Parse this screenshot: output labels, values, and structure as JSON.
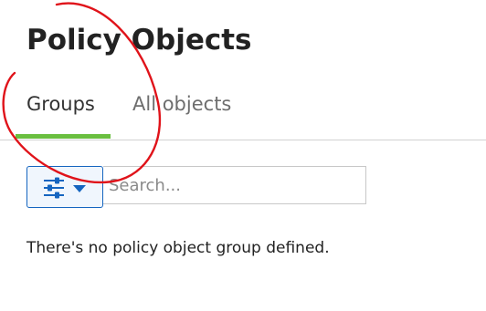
{
  "header": {
    "title": "Policy Objects"
  },
  "tabs": [
    {
      "label": "Groups",
      "active": true
    },
    {
      "label": "All objects",
      "active": false
    }
  ],
  "toolbar": {
    "filter_icon": "sliders-icon",
    "filter_caret_icon": "caret-down-icon",
    "search_placeholder": "Search...",
    "search_value": ""
  },
  "main": {
    "empty_message": "There's no policy object group defined."
  },
  "colors": {
    "active_tab_indicator": "#6abf40",
    "filter_button_border": "#1565c0",
    "filter_icon": "#1565c0",
    "annotation_stroke": "#e0131a"
  }
}
